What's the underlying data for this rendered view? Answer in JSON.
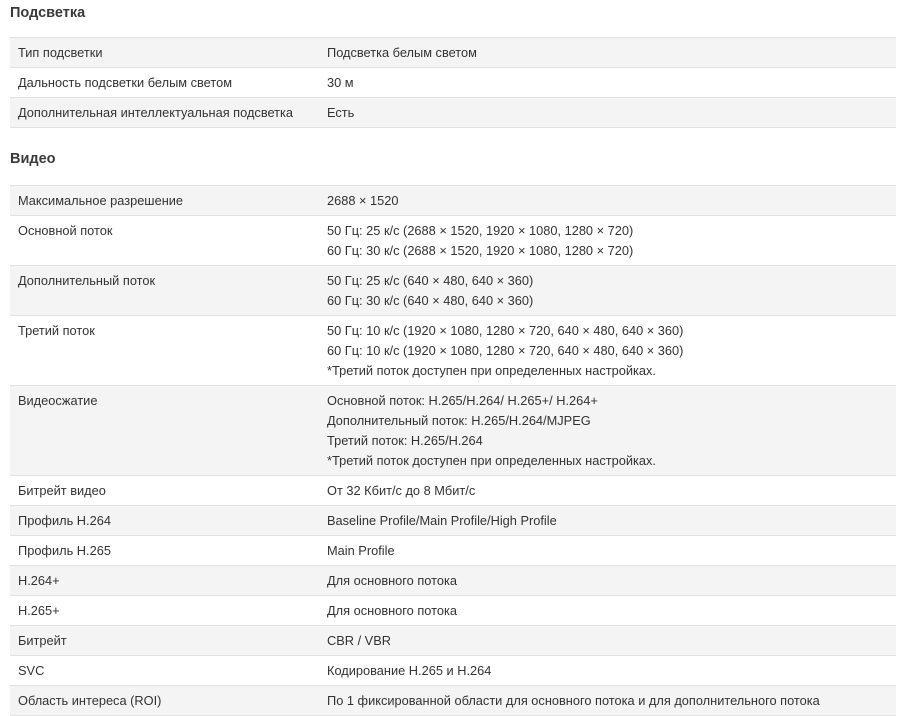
{
  "sections": [
    {
      "title": "Подсветка",
      "rows": [
        {
          "label": "Тип подсветки",
          "lines": [
            "Подсветка белым светом"
          ]
        },
        {
          "label": "Дальность подсветки белым светом",
          "lines": [
            "30 м"
          ]
        },
        {
          "label": "Дополнительная интеллектуальная подсветка",
          "lines": [
            "Есть"
          ]
        }
      ]
    },
    {
      "title": "Видео",
      "rows": [
        {
          "label": "Максимальное разрешение",
          "lines": [
            "2688 × 1520"
          ]
        },
        {
          "label": "Основной поток",
          "lines": [
            "50 Гц: 25 к/с (2688 × 1520, 1920 × 1080, 1280 × 720)",
            "60 Гц: 30 к/с (2688 × 1520, 1920 × 1080, 1280 × 720)"
          ]
        },
        {
          "label": "Дополнительный поток",
          "lines": [
            "50 Гц: 25 к/с (640 × 480, 640 × 360)",
            "60 Гц: 30 к/с (640 × 480, 640 × 360)"
          ]
        },
        {
          "label": "Третий поток",
          "lines": [
            "50 Гц: 10 к/с (1920 × 1080, 1280 × 720, 640 × 480, 640 × 360)",
            "60 Гц: 10 к/с (1920 × 1080, 1280 × 720, 640 × 480, 640 × 360)",
            "*Третий поток доступен при определенных настройках."
          ]
        },
        {
          "label": "Видеосжатие",
          "lines": [
            "Основной поток: H.265/H.264/ H.265+/ H.264+",
            "Дополнительный поток: H.265/H.264/MJPEG",
            "Третий поток: H.265/H.264",
            "*Третий поток доступен при определенных настройках."
          ]
        },
        {
          "label": "Битрейт видео",
          "lines": [
            "От 32 Кбит/с до 8 Мбит/с"
          ]
        },
        {
          "label": "Профиль H.264",
          "lines": [
            "Baseline Profile/Main Profile/High Profile"
          ]
        },
        {
          "label": "Профиль H.265",
          "lines": [
            "Main Profile"
          ]
        },
        {
          "label": "H.264+",
          "lines": [
            "Для основного потока"
          ]
        },
        {
          "label": "H.265+",
          "lines": [
            "Для основного потока"
          ]
        },
        {
          "label": "Битрейт",
          "lines": [
            "CBR / VBR"
          ]
        },
        {
          "label": "SVC",
          "lines": [
            "Кодирование H.265 и H.264"
          ]
        },
        {
          "label": "Область интереса (ROI)",
          "lines": [
            "По 1 фиксированной области для основного потока и для дополнительного потока"
          ]
        }
      ]
    }
  ]
}
